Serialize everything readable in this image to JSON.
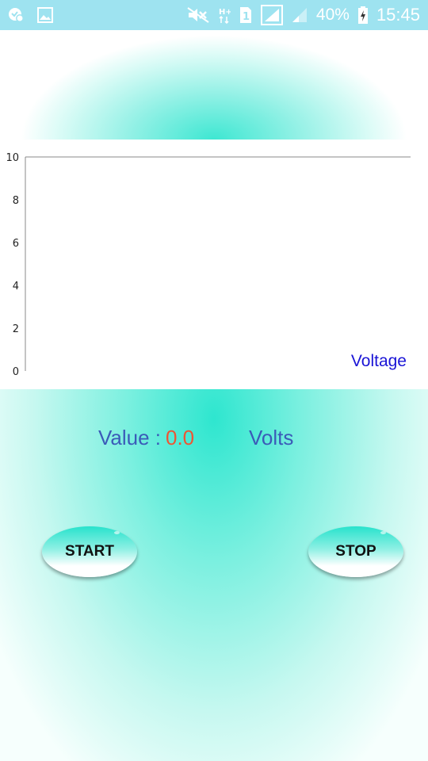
{
  "status_bar": {
    "battery_percent": "40%",
    "time": "15:45",
    "icons": [
      "notification-icon",
      "image-icon",
      "mute-icon",
      "hplus-data-icon",
      "sim-1-icon",
      "signal-icon",
      "signal-weak-icon",
      "battery-charging-icon"
    ]
  },
  "chart_data": {
    "type": "line",
    "title": "",
    "xlabel": "",
    "ylabel": "",
    "ylim": [
      0,
      10
    ],
    "y_ticks": [
      "0",
      "2",
      "4",
      "6",
      "8",
      "10"
    ],
    "series": [
      {
        "name": "Voltage",
        "values": []
      }
    ],
    "legend_position": "bottom-right",
    "legend_color": "#1a14d6"
  },
  "reading": {
    "label": "Value :",
    "value": "0.0",
    "unit": "Volts"
  },
  "buttons": {
    "start_label": "START",
    "stop_label": "STOP"
  }
}
